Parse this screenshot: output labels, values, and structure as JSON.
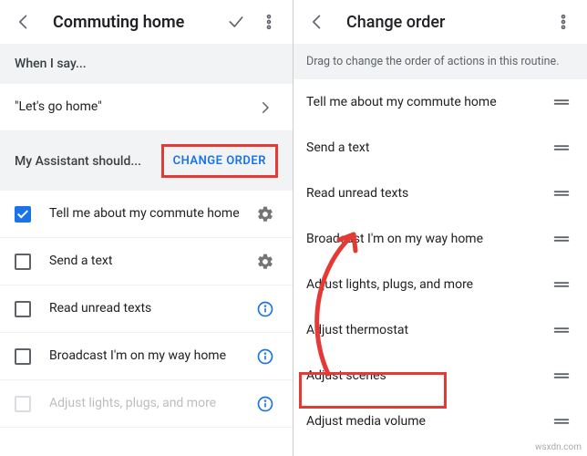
{
  "left": {
    "title": "Commuting home",
    "when_header": "When I say...",
    "phrase": "\"Let's go home\"",
    "should_header": "My Assistant should...",
    "change_order": "CHANGE ORDER",
    "actions": [
      {
        "label": "Tell me about my commute home",
        "checked": true,
        "trail": "gear"
      },
      {
        "label": "Send a text",
        "checked": false,
        "trail": "gear"
      },
      {
        "label": "Read unread texts",
        "checked": false,
        "trail": "info"
      },
      {
        "label": "Broadcast I'm on my way home",
        "checked": false,
        "trail": "info"
      },
      {
        "label": "Adjust lights, plugs, and more",
        "checked": false,
        "trail": "info",
        "disabled": true
      }
    ]
  },
  "right": {
    "title": "Change order",
    "banner": "Drag to change the order of actions in this routine.",
    "items": [
      "Tell me about my commute home",
      "Send a text",
      "Read unread texts",
      "Broadcast I'm on my way home",
      "Adjust lights, plugs, and more",
      "Adjust thermostat",
      "Adjust scenes",
      "Adjust media volume"
    ]
  },
  "watermark": "wsxdn.com"
}
